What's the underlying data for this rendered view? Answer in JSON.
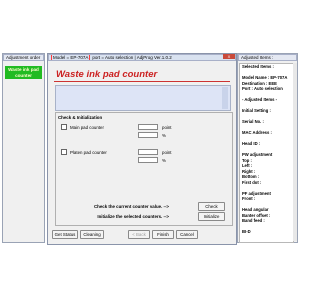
{
  "left_window": {
    "title": "Adjustment order",
    "selected_item": "Waste ink pad counter"
  },
  "main_window": {
    "title_model": "Model = EP-707A",
    "title_rest": "port = Auto selection | AdjProg Ver.1.0.2",
    "close": "X",
    "page_title": "Waste ink pad counter",
    "group_title": "Check & Initialization",
    "rows": [
      {
        "label": "Main pad counter",
        "unit_point": "point",
        "unit_percent": "%"
      },
      {
        "label": "Platen pad counter",
        "unit_point": "point",
        "unit_percent": "%"
      }
    ],
    "check_text": "Check the current counter value. -->",
    "check_button": "Check",
    "init_text": "Initialize the selected counters. -->",
    "init_button": "Initialize",
    "buttons": {
      "get_status": "Get Status",
      "cleaning": "Cleaning",
      "back": "< Back",
      "finish": "Finish",
      "cancel": "Cancel"
    }
  },
  "right_window": {
    "title": "Adjusted Items :",
    "items": [
      {
        "text": "Selected Items :",
        "bold": true
      },
      {
        "text": "",
        "bold": false
      },
      {
        "text": "Model Name : EP-707A",
        "bold": true
      },
      {
        "text": "Destination : EEE",
        "bold": true
      },
      {
        "text": "Port : Auto selection",
        "bold": true
      },
      {
        "text": "",
        "bold": false
      },
      {
        "text": "- Adjusted Items -",
        "bold": true
      },
      {
        "text": "",
        "bold": false
      },
      {
        "text": "Initial Setting :",
        "bold": true
      },
      {
        "text": "",
        "bold": false
      },
      {
        "text": "Serial No. :",
        "bold": true
      },
      {
        "text": "",
        "bold": false
      },
      {
        "text": "MAC Address :",
        "bold": true
      },
      {
        "text": "",
        "bold": false
      },
      {
        "text": "Head ID :",
        "bold": true
      },
      {
        "text": "",
        "bold": false
      },
      {
        "text": "PW adjustment",
        "bold": true
      },
      {
        "text": "Top :",
        "bold": true
      },
      {
        "text": "Left :",
        "bold": true
      },
      {
        "text": "Right :",
        "bold": true
      },
      {
        "text": "Bottom :",
        "bold": true
      },
      {
        "text": "First dot :",
        "bold": true
      },
      {
        "text": "",
        "bold": false
      },
      {
        "text": "PF adjustment",
        "bold": true
      },
      {
        "text": "Front :",
        "bold": true
      },
      {
        "text": "",
        "bold": false
      },
      {
        "text": "Head angular",
        "bold": true
      },
      {
        "text": "Banter offset :",
        "bold": true
      },
      {
        "text": "Band feed :",
        "bold": true
      },
      {
        "text": "",
        "bold": false
      },
      {
        "text": "BI-D",
        "bold": true
      }
    ]
  }
}
